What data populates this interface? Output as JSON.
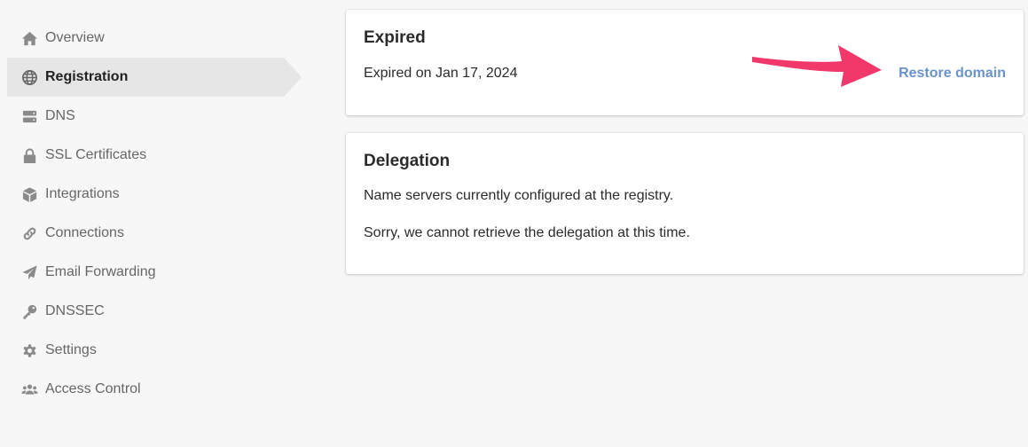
{
  "sidebar": {
    "items": [
      {
        "label": "Overview",
        "icon": "home-icon"
      },
      {
        "label": "Registration",
        "icon": "globe-icon",
        "active": true
      },
      {
        "label": "DNS",
        "icon": "server-icon"
      },
      {
        "label": "SSL Certificates",
        "icon": "lock-icon"
      },
      {
        "label": "Integrations",
        "icon": "box-icon"
      },
      {
        "label": "Connections",
        "icon": "link-icon"
      },
      {
        "label": "Email Forwarding",
        "icon": "paper-plane-icon"
      },
      {
        "label": "DNSSEC",
        "icon": "key-icon"
      },
      {
        "label": "Settings",
        "icon": "gear-icon"
      },
      {
        "label": "Access Control",
        "icon": "users-icon"
      }
    ]
  },
  "expired_card": {
    "title": "Expired",
    "status_text": "Expired on Jan 17, 2024",
    "restore_label": "Restore domain"
  },
  "delegation_card": {
    "title": "Delegation",
    "description": "Name servers currently configured at the registry.",
    "error_text": "Sorry, we cannot retrieve the delegation at this time."
  },
  "colors": {
    "link": "#6a93c9",
    "arrow": "#f2386b",
    "active_bg": "#e6e6e6"
  }
}
